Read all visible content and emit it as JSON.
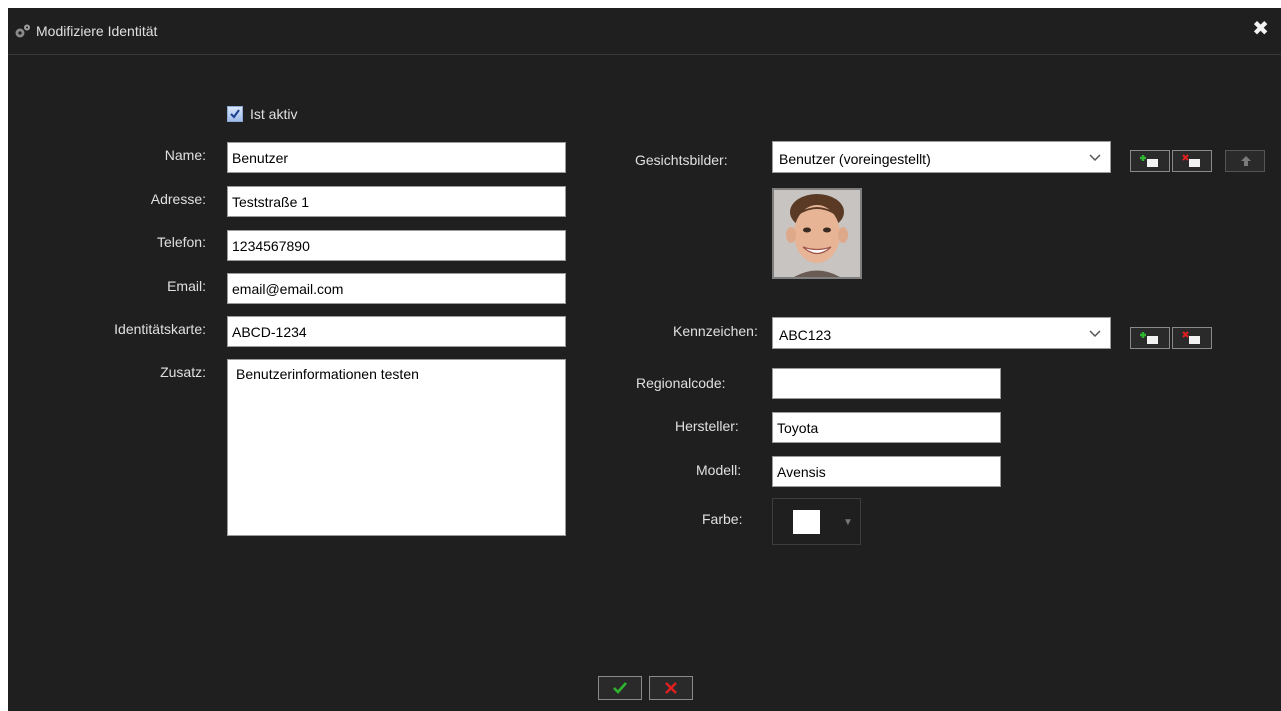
{
  "window": {
    "title": "Modifiziere Identität",
    "close_icon": "close-icon"
  },
  "form": {
    "active_label": "Ist aktiv",
    "active_checked": true,
    "name_label": "Name:",
    "name_value": "Benutzer",
    "address_label": "Adresse:",
    "address_value": "Teststraße 1",
    "phone_label": "Telefon:",
    "phone_value": "1234567890",
    "email_label": "Email:",
    "email_value": "email@email.com",
    "idcard_label": "Identitätskarte:",
    "idcard_value": "ABCD-1234",
    "extra_label": "Zusatz:",
    "extra_value": "Benutzerinformationen testen"
  },
  "faces": {
    "label": "Gesichtsbilder:",
    "selected": "Benutzer (voreingestellt)",
    "add_icon": "add-image-icon",
    "remove_icon": "remove-image-icon",
    "upload_icon": "upload-arrow-icon"
  },
  "plate": {
    "label": "Kennzeichen:",
    "selected": "ABC123",
    "region_label": "Regionalcode:",
    "region_value": "",
    "maker_label": "Hersteller:",
    "maker_value": "Toyota",
    "model_label": "Modell:",
    "model_value": "Avensis",
    "color_label": "Farbe:",
    "color_value": "#ffffff"
  },
  "footer": {
    "ok_icon": "checkmark-icon",
    "cancel_icon": "cancel-x-icon"
  },
  "colors": {
    "background": "#1f1f1f",
    "ok_green": "#2fb52f",
    "cancel_red": "#e02020"
  }
}
